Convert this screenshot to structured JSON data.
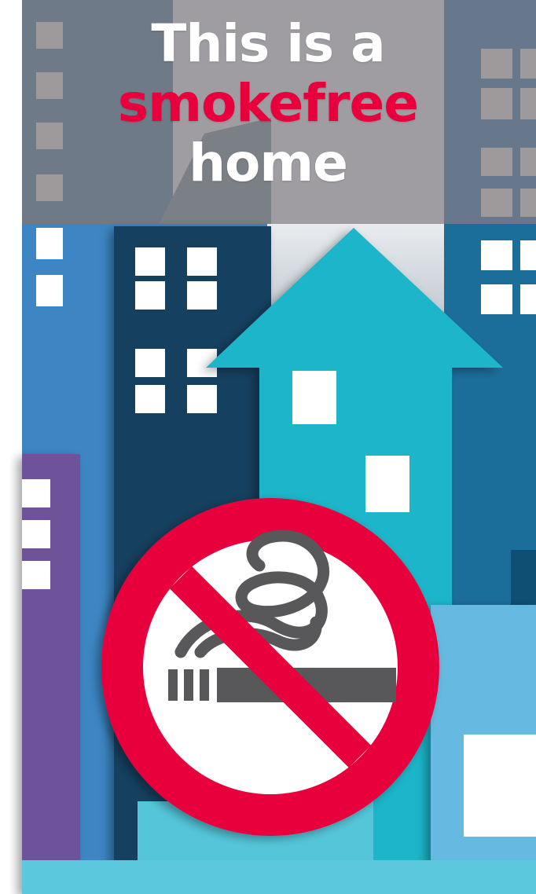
{
  "headline": {
    "line1": "This is a",
    "line2": "smokefree",
    "line3": "home"
  },
  "colors": {
    "headline_white": "#ffffff",
    "headline_red": "#e8003d",
    "sign_red": "#e8003d",
    "cigarette_gray": "#58585a",
    "gray_sky": "#9f9da1",
    "slate_building": "#67778c",
    "navy_building": "#163f5e",
    "blue_building": "#3f87c4",
    "teal_arrow": "#1fb5c9",
    "light_blue_building": "#66b9e0",
    "purple_building": "#6e539b",
    "white_window": "#ffffff"
  },
  "icons": {
    "sign": "no-smoking-icon",
    "arrow": "house-arrow-icon"
  }
}
